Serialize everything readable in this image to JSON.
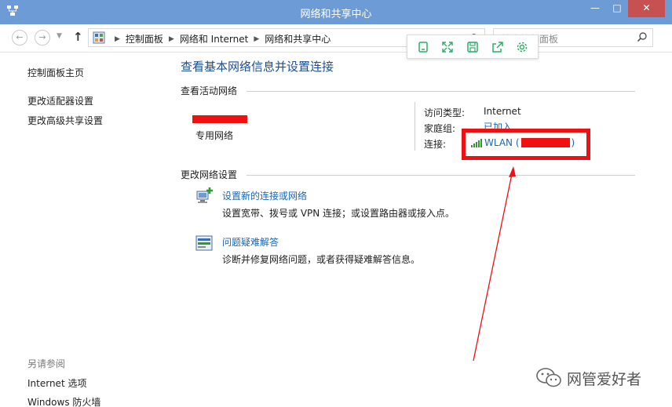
{
  "window": {
    "title": "网络和共享中心",
    "min_glyph": "—",
    "max_glyph": "□",
    "close_glyph": "✕"
  },
  "nav": {
    "back_glyph": "←",
    "forward_glyph": "→",
    "recent_glyph": "▼",
    "up_glyph": "↑",
    "refresh_glyph": "↻",
    "breadcrumbs": [
      "控制面板",
      "网络和 Internet",
      "网络和共享中心"
    ],
    "breadcrumb_sep": "▶",
    "search_placeholder": "搜索控制面板"
  },
  "left": {
    "home": "控制面板主页",
    "adapter": "更改适配器设置",
    "sharing": "更改高级共享设置",
    "see_also": "另请参阅",
    "internet_options": "Internet 选项",
    "firewall": "Windows 防火墙"
  },
  "main": {
    "title": "查看基本网络信息并设置连接",
    "active_heading": "查看活动网络",
    "network_type": "专用网络",
    "access_type_label": "访问类型:",
    "access_type_value": "Internet",
    "homegroup_label": "家庭组:",
    "homegroup_value": "已加入",
    "connection_label": "连接:",
    "connection_name": "WLAN (",
    "connection_close": ")",
    "change_heading": "更改网络设置",
    "task1_link": "设置新的连接或网络",
    "task1_desc": "设置宽带、拨号或 VPN 连接；或设置路由器或接入点。",
    "task2_link": "问题疑难解答",
    "task2_desc": "诊断并修复网络问题，或者获得疑难解答信息。"
  },
  "watermark": {
    "text": "网管爱好者"
  },
  "colors": {
    "titlebar": "#6c9bd6",
    "link": "#1c67b5",
    "title_blue": "#1f4e8c",
    "annotation_red": "#ee1111",
    "toolbar_green": "#2fae6a"
  },
  "icons": [
    "control-panel-icon",
    "search-icon",
    "copy-icon",
    "expand-icon",
    "save-icon",
    "share-icon",
    "settings-icon",
    "wifi-signal-icon",
    "new-connection-icon",
    "troubleshoot-icon",
    "wechat-icon"
  ]
}
